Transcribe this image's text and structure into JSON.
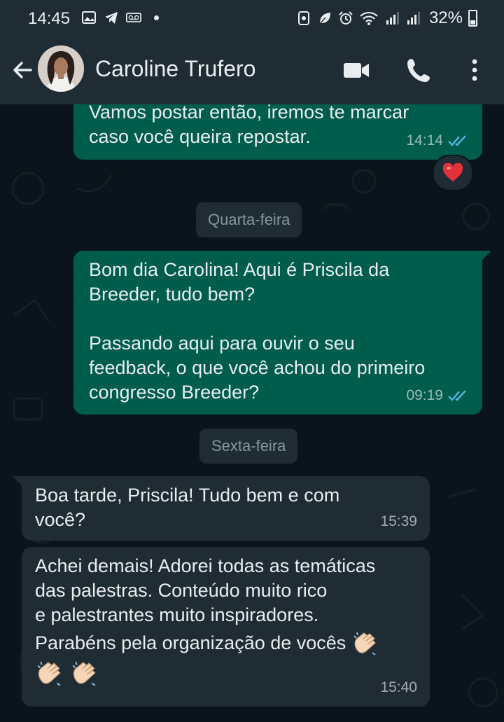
{
  "status_bar": {
    "time": "14:45",
    "battery": "32%"
  },
  "header": {
    "contact_name": "Caroline Trufero"
  },
  "messages": [
    {
      "direction": "out",
      "text": "Vamos postar então, iremos te marcar\ncaso você queira repostar.",
      "time": "14:14",
      "status": "read",
      "reaction": "heart"
    },
    {
      "direction": "out",
      "text": "Bom dia Carolina! Aqui é Priscila da\nBreeder, tudo bem?\n\nPassando aqui para ouvir o seu\nfeedback, o que você achou do primeiro\ncongresso Breeder?",
      "time": "09:19",
      "status": "read"
    },
    {
      "direction": "in",
      "text": "Boa tarde, Priscila! Tudo bem e com\nvocê?",
      "time": "15:39"
    },
    {
      "direction": "in",
      "text_line1": "Achei demais! Adorei todas as temáticas",
      "text_line2": "das palestras. Conteúdo muito rico",
      "text_line3": "e palestrantes muito inspiradores.",
      "text_line4": "Parabéns pela organização de vocês",
      "emoji": "clapping-hands",
      "time": "15:40"
    }
  ],
  "date_separators": [
    "Quarta-feira",
    "Sexta-feira"
  ],
  "colors": {
    "outgoing_bubble": "#005c4b",
    "incoming_bubble": "#202c33",
    "header": "#1f2c34",
    "background": "#0b141a",
    "read_ticks": "#53bdeb"
  }
}
